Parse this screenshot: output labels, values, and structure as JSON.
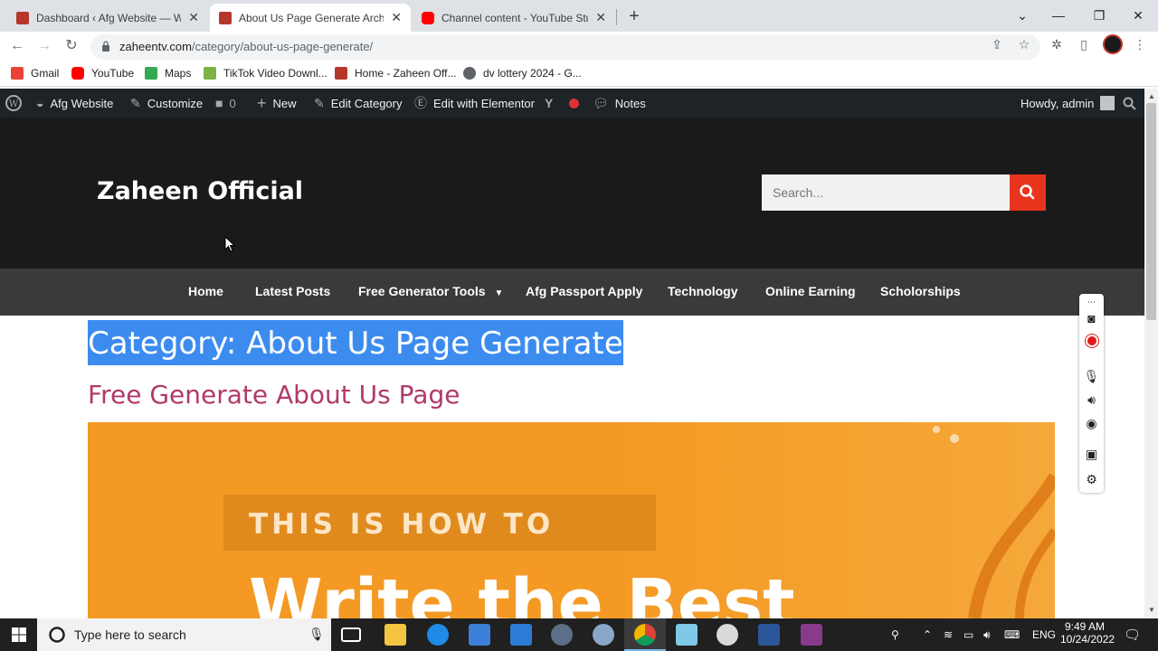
{
  "browser": {
    "tabs": [
      {
        "title": "Dashboard ‹ Afg Website — Wor",
        "active": false
      },
      {
        "title": "About Us Page Generate Archive",
        "active": true
      },
      {
        "title": "Channel content - YouTube Studi",
        "active": false
      }
    ],
    "url_domain": "zaheentv.com",
    "url_path": "/category/about-us-page-generate/",
    "bookmarks": [
      "Gmail",
      "YouTube",
      "Maps",
      "TikTok Video Downl...",
      "Home - Zaheen Off...",
      "dv lottery 2024 - G..."
    ]
  },
  "adminbar": {
    "site_name": "Afg Website",
    "customize": "Customize",
    "comments_count": "0",
    "new": "New",
    "edit_category": "Edit Category",
    "edit_elementor": "Edit with Elementor",
    "notes": "Notes",
    "howdy": "Howdy, admin"
  },
  "site": {
    "title": "Zaheen Official",
    "search_placeholder": "Search...",
    "nav": [
      "Home",
      "Latest Posts",
      "Free Generator Tools",
      "Afg Passport Apply",
      "Technology",
      "Online Earning",
      "Scholorships"
    ]
  },
  "content": {
    "category_title": "Category: About Us Page Generate",
    "post_title": "Free Generate About Us Page",
    "image_line1": "THIS IS HOW TO",
    "image_line2": "Write the Best"
  },
  "taskbar": {
    "search_placeholder": "Type here to search",
    "lang": "ENG",
    "time": "9:49 AM",
    "date": "10/24/2022"
  },
  "colors": {
    "admin_bar": "#1d2327",
    "header_bg": "#1a1a1a",
    "nav_bg": "#3a3a3a",
    "search_button": "#e8341c",
    "selection": "#3c8cf0",
    "post_title": "#b03a6b",
    "feature_image": "#f49a24"
  }
}
